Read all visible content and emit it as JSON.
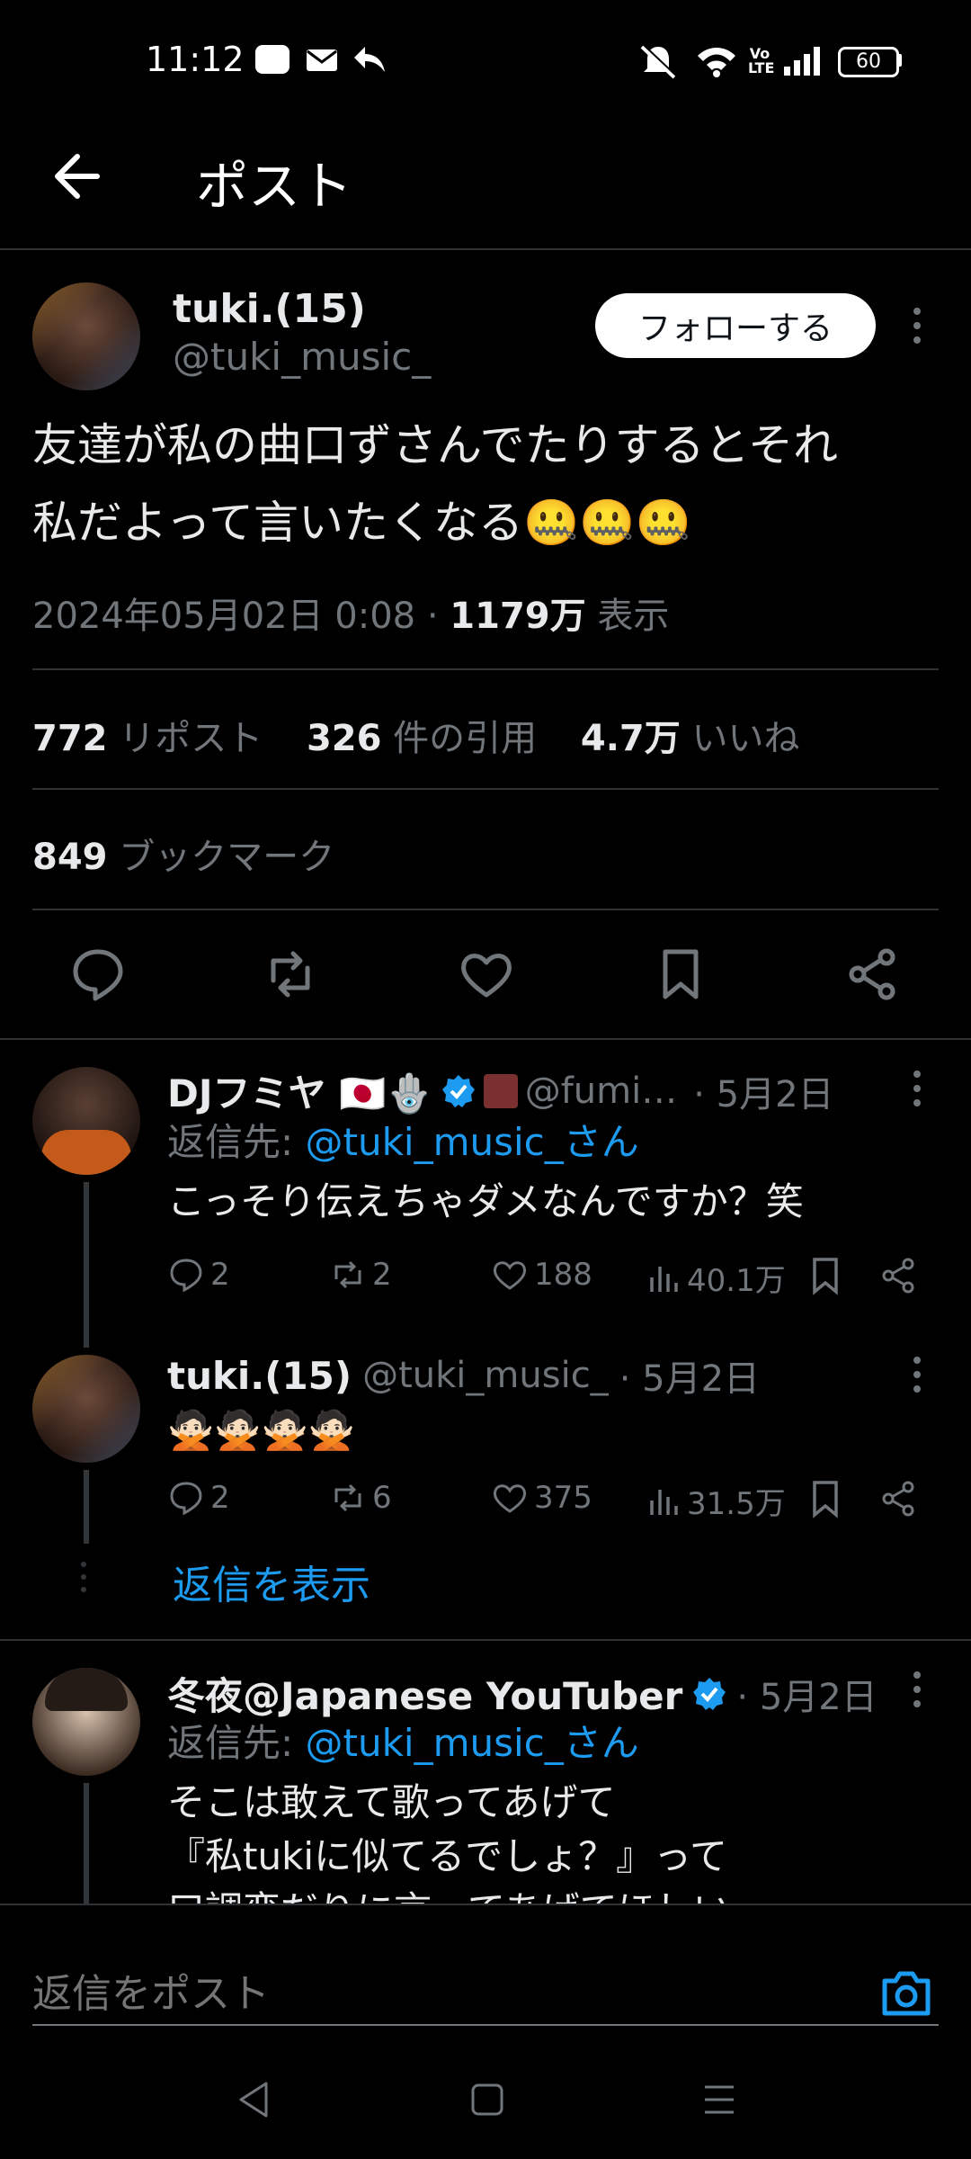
{
  "status_bar": {
    "time": "11:12",
    "battery": "60",
    "volte": "Vo LTE"
  },
  "header": {
    "title": "ポスト"
  },
  "post": {
    "name": "tuki.(15)",
    "handle": "@tuki_music_",
    "follow_label": "フォローする",
    "text_line1": "友達が私の曲口ずさんでたりするとそれ",
    "text_line2": "私だよって言いたくなる",
    "emoji": "🤐🤐🤐",
    "date": "2024年05月02日 0:08 · ",
    "views": "1179万",
    "views_label": " 表示",
    "reposts": "772",
    "reposts_label": " リポスト",
    "quotes": "326",
    "quotes_label": " 件の引用",
    "likes": "4.7万",
    "likes_label": " いいね",
    "bookmarks": "849",
    "bookmarks_label": " ブックマーク"
  },
  "replies": [
    {
      "name": "DJフミヤ 🇯🇵🪬",
      "handle": "@fumi…",
      "time": "· 5月2日",
      "reply_to_label": "返信先: ",
      "reply_to": "@tuki_music_さん",
      "text": "こっそり伝えちゃダメなんですか？笑",
      "replies": "2",
      "reposts": "2",
      "likes": "188",
      "views": "40.1万"
    },
    {
      "name": "tuki.(15)",
      "handle": "@tuki_music_",
      "time": "· 5月2日",
      "text": "🙅🏻🙅🏻🙅🏻🙅🏻",
      "replies": "2",
      "reposts": "6",
      "likes": "375",
      "views": "31.5万"
    },
    {
      "name": "冬夜@Japanese YouTuber",
      "time": "· 5月2日",
      "reply_to_label": "返信先: ",
      "reply_to": "@tuki_music_さん",
      "text_line1": "そこは敢えて歌ってあげて",
      "text_line2": "『私tukiに似てるでしょ？』って",
      "text_line3": "口調変だりに言ってあげてほしい"
    }
  ],
  "show_replies": "返信を表示",
  "composer": {
    "placeholder": "返信をポスト"
  },
  "colors": {
    "background": "#000000",
    "link": "#1d9bf0",
    "verified": "#1d9bf0",
    "muted": "#71767b"
  }
}
